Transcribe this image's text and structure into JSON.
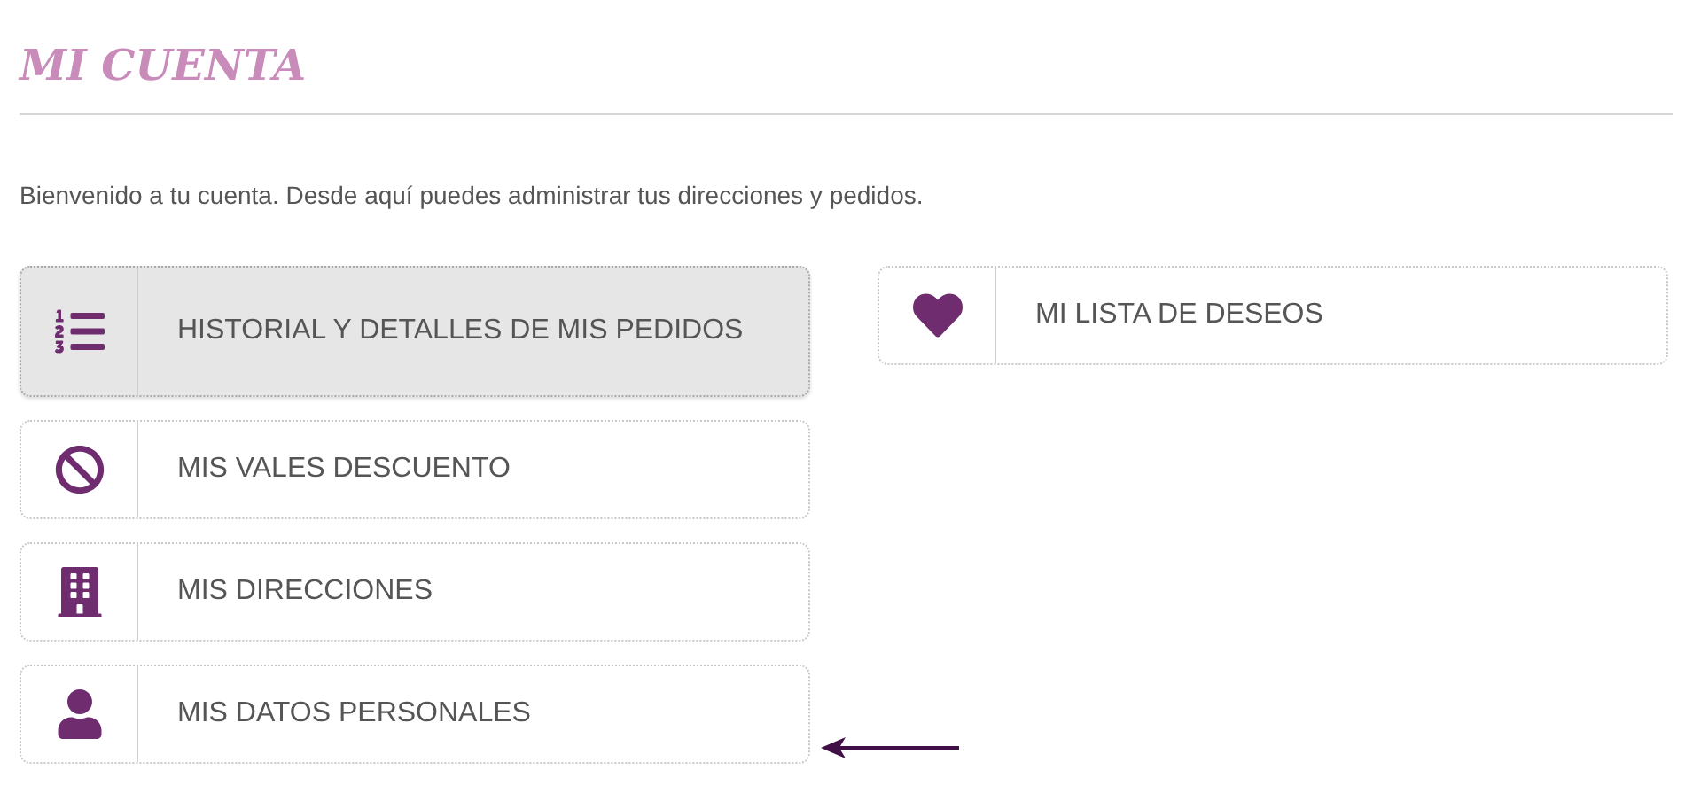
{
  "page_title": "MI CUENTA",
  "intro": "Bienvenido a tu cuenta. Desde aquí puedes administrar tus direcciones y pedidos.",
  "left_links": [
    {
      "kind": "orders",
      "label": "HISTORIAL Y DETALLES DE MIS PEDIDOS",
      "selected": true
    },
    {
      "kind": "vouchers",
      "label": "MIS VALES DESCUENTO",
      "selected": false
    },
    {
      "kind": "addresses",
      "label": "MIS DIRECCIONES",
      "selected": false
    },
    {
      "kind": "personal",
      "label": "MIS DATOS PERSONALES",
      "selected": false
    }
  ],
  "right_links": [
    {
      "kind": "wishlist",
      "label": "MI LISTA DE DESEOS",
      "selected": false
    }
  ]
}
